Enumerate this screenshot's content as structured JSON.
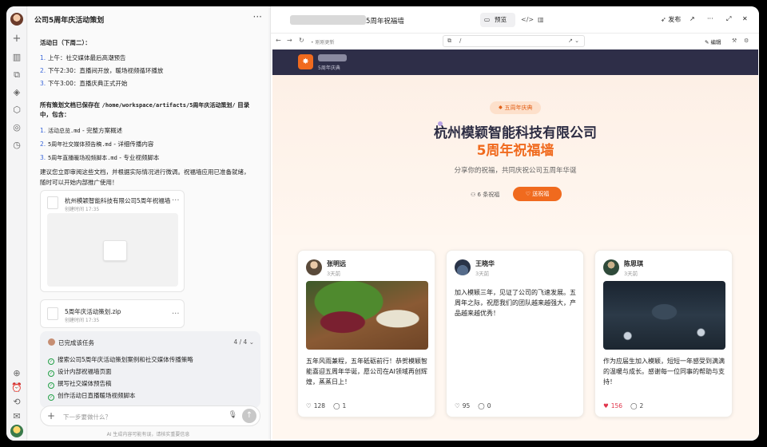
{
  "chat": {
    "title": "公司5周年庆活动策划",
    "schedule_heading": "活动日（下周二）：",
    "schedule": [
      {
        "n": "1.",
        "text": "上午：社交媒体最后高潮预告"
      },
      {
        "n": "2.",
        "text": "下午2:30：直播间开放，暖场视频循环播放"
      },
      {
        "n": "3.",
        "text": "下午3:00：直播庆典正式开始"
      }
    ],
    "saved_line1": "所有策划文档已保存在 ",
    "saved_path": "/home/workspace/artifacts/5周年庆活动策划/",
    "saved_line1_end": " 目录",
    "saved_line2": "中，包含：",
    "docs": [
      {
        "n": "1.",
        "file": "活动总览.md",
        "desc": " - 完整方案概述"
      },
      {
        "n": "2.",
        "file": "5周年社交媒体预告稿.md",
        "desc": " - 详细传播内容"
      },
      {
        "n": "3.",
        "file": "5周年直播暖场视频脚本.md",
        "desc": " - 专业视频脚本"
      }
    ],
    "advice_line1": "建议您立即审阅这些文档，并根据实际情况进行微调。祝福墙应用已准备就绪，",
    "advice_line2": "随时可以开始内部推广使用！",
    "artifact1": {
      "title": "杭州模颖智能科技有限公司5周年祝福墙",
      "time": "创建时间 17:35"
    },
    "artifact2": {
      "title": "5周年庆活动策划.zip",
      "time": "创建时间 17:35"
    },
    "tasks_header": "已完成该任务",
    "tasks_count": "4 / 4",
    "tasks": [
      "搜索公司5周年庆活动策划案例和社交媒体传播策略",
      "设计内部祝福墙页面",
      "撰写社交媒体预告稿",
      "创作活动日直播暖场视频脚本"
    ],
    "input_placeholder": "下一步要做什么？",
    "disclaimer": "AI 生成内容可能有误，请核实重要信息"
  },
  "browser": {
    "tab_title": "5周年祝福墙",
    "preview_label": "预览",
    "publish_label": "发布",
    "refresh_label": "刚刚更新",
    "url": "/",
    "edit_label": "编辑"
  },
  "page": {
    "nav_sub": "5周年庆典",
    "badge": "五周年庆典",
    "company": "杭州模颖智能科技有限公司",
    "wall_title": "5周年祝福墙",
    "tagline": "分享你的祝福，共同庆祝公司五周年华诞",
    "count": "6 条祝福",
    "send_button": "送祝福",
    "accent": "#f06a1e",
    "nav_bg": "#2e2e48"
  },
  "wishes": [
    {
      "name": "张明远",
      "time": "3天前",
      "text": "五年风雨兼程，五年砥砺前行！恭贺模颖智能喜迎五周年华诞，愿公司在AI领域再创辉煌，蒸蒸日上！",
      "likes": "128",
      "comments": "1",
      "liked": false
    },
    {
      "name": "王晓华",
      "time": "3天前",
      "text": "加入模颖三年，见证了公司的飞速发展。五周年之际，祝愿我们的团队越来越强大，产品越来越优秀！",
      "likes": "95",
      "comments": "0",
      "liked": false
    },
    {
      "name": "陈思琪",
      "time": "3天前",
      "text": "作为应届生加入模颖，短短一年感受到满满的温暖与成长。感谢每一位同事的帮助与支持！",
      "likes": "156",
      "comments": "2",
      "liked": true
    }
  ]
}
